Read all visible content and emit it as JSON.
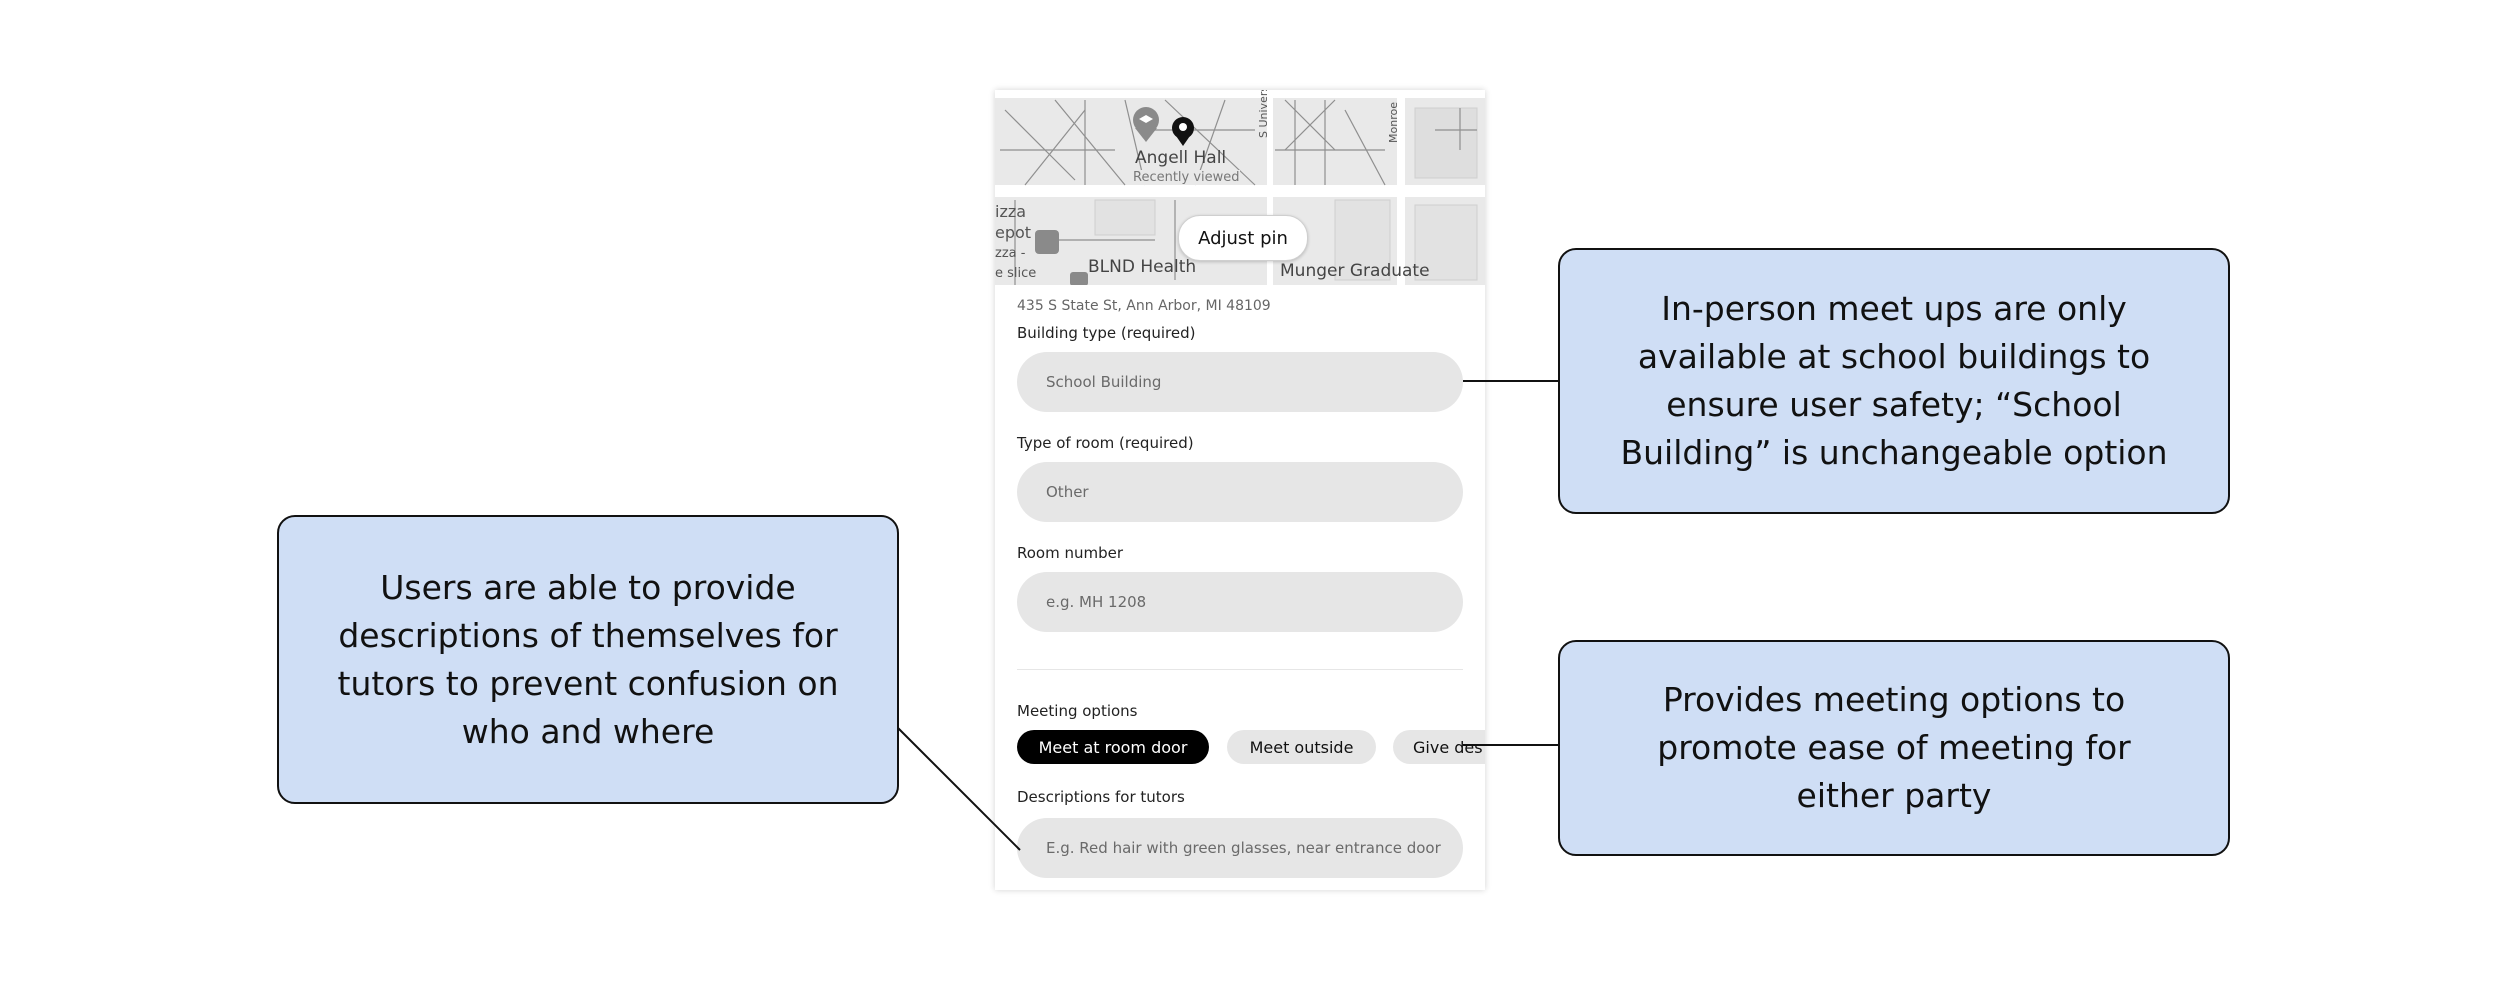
{
  "map": {
    "place_name": "Angell Hall",
    "place_sub": "Recently viewed",
    "street_1": "S Univers",
    "street_2": "Monroe",
    "left_text_1": "izza",
    "left_text_2": "epot",
    "left_text_3": "zza -",
    "left_text_4": "e slice",
    "poi_1": "BLND Health",
    "poi_2": "Munger Graduate",
    "adjust_pin_label": "Adjust pin"
  },
  "form": {
    "address": "435 S State St, Ann Arbor, MI 48109",
    "building_type_label": "Building type (required)",
    "building_type_value": "School Building",
    "room_type_label": "Type of room (required)",
    "room_type_value": "Other",
    "room_number_label": "Room number",
    "room_number_placeholder": "e.g. MH 1208",
    "meeting_options_label": "Meeting options",
    "meeting_options": [
      "Meet at room door",
      "Meet outside",
      "Give des"
    ],
    "descriptions_label": "Descriptions for tutors",
    "descriptions_placeholder": "E.g. Red hair with green glasses, near entrance door"
  },
  "callouts": {
    "building": "In-person meet ups are only available at school buildings to ensure user safety; “School Building” is unchangeable option",
    "meeting": "Provides meeting options to promote ease of meeting for either party",
    "descriptions": "Users are able to provide descriptions of themselves for tutors to prevent confusion on who and where"
  },
  "colors": {
    "callout_fill": "#cfdef5",
    "field_fill": "#e6e6e6",
    "chip_selected": "#000000"
  }
}
